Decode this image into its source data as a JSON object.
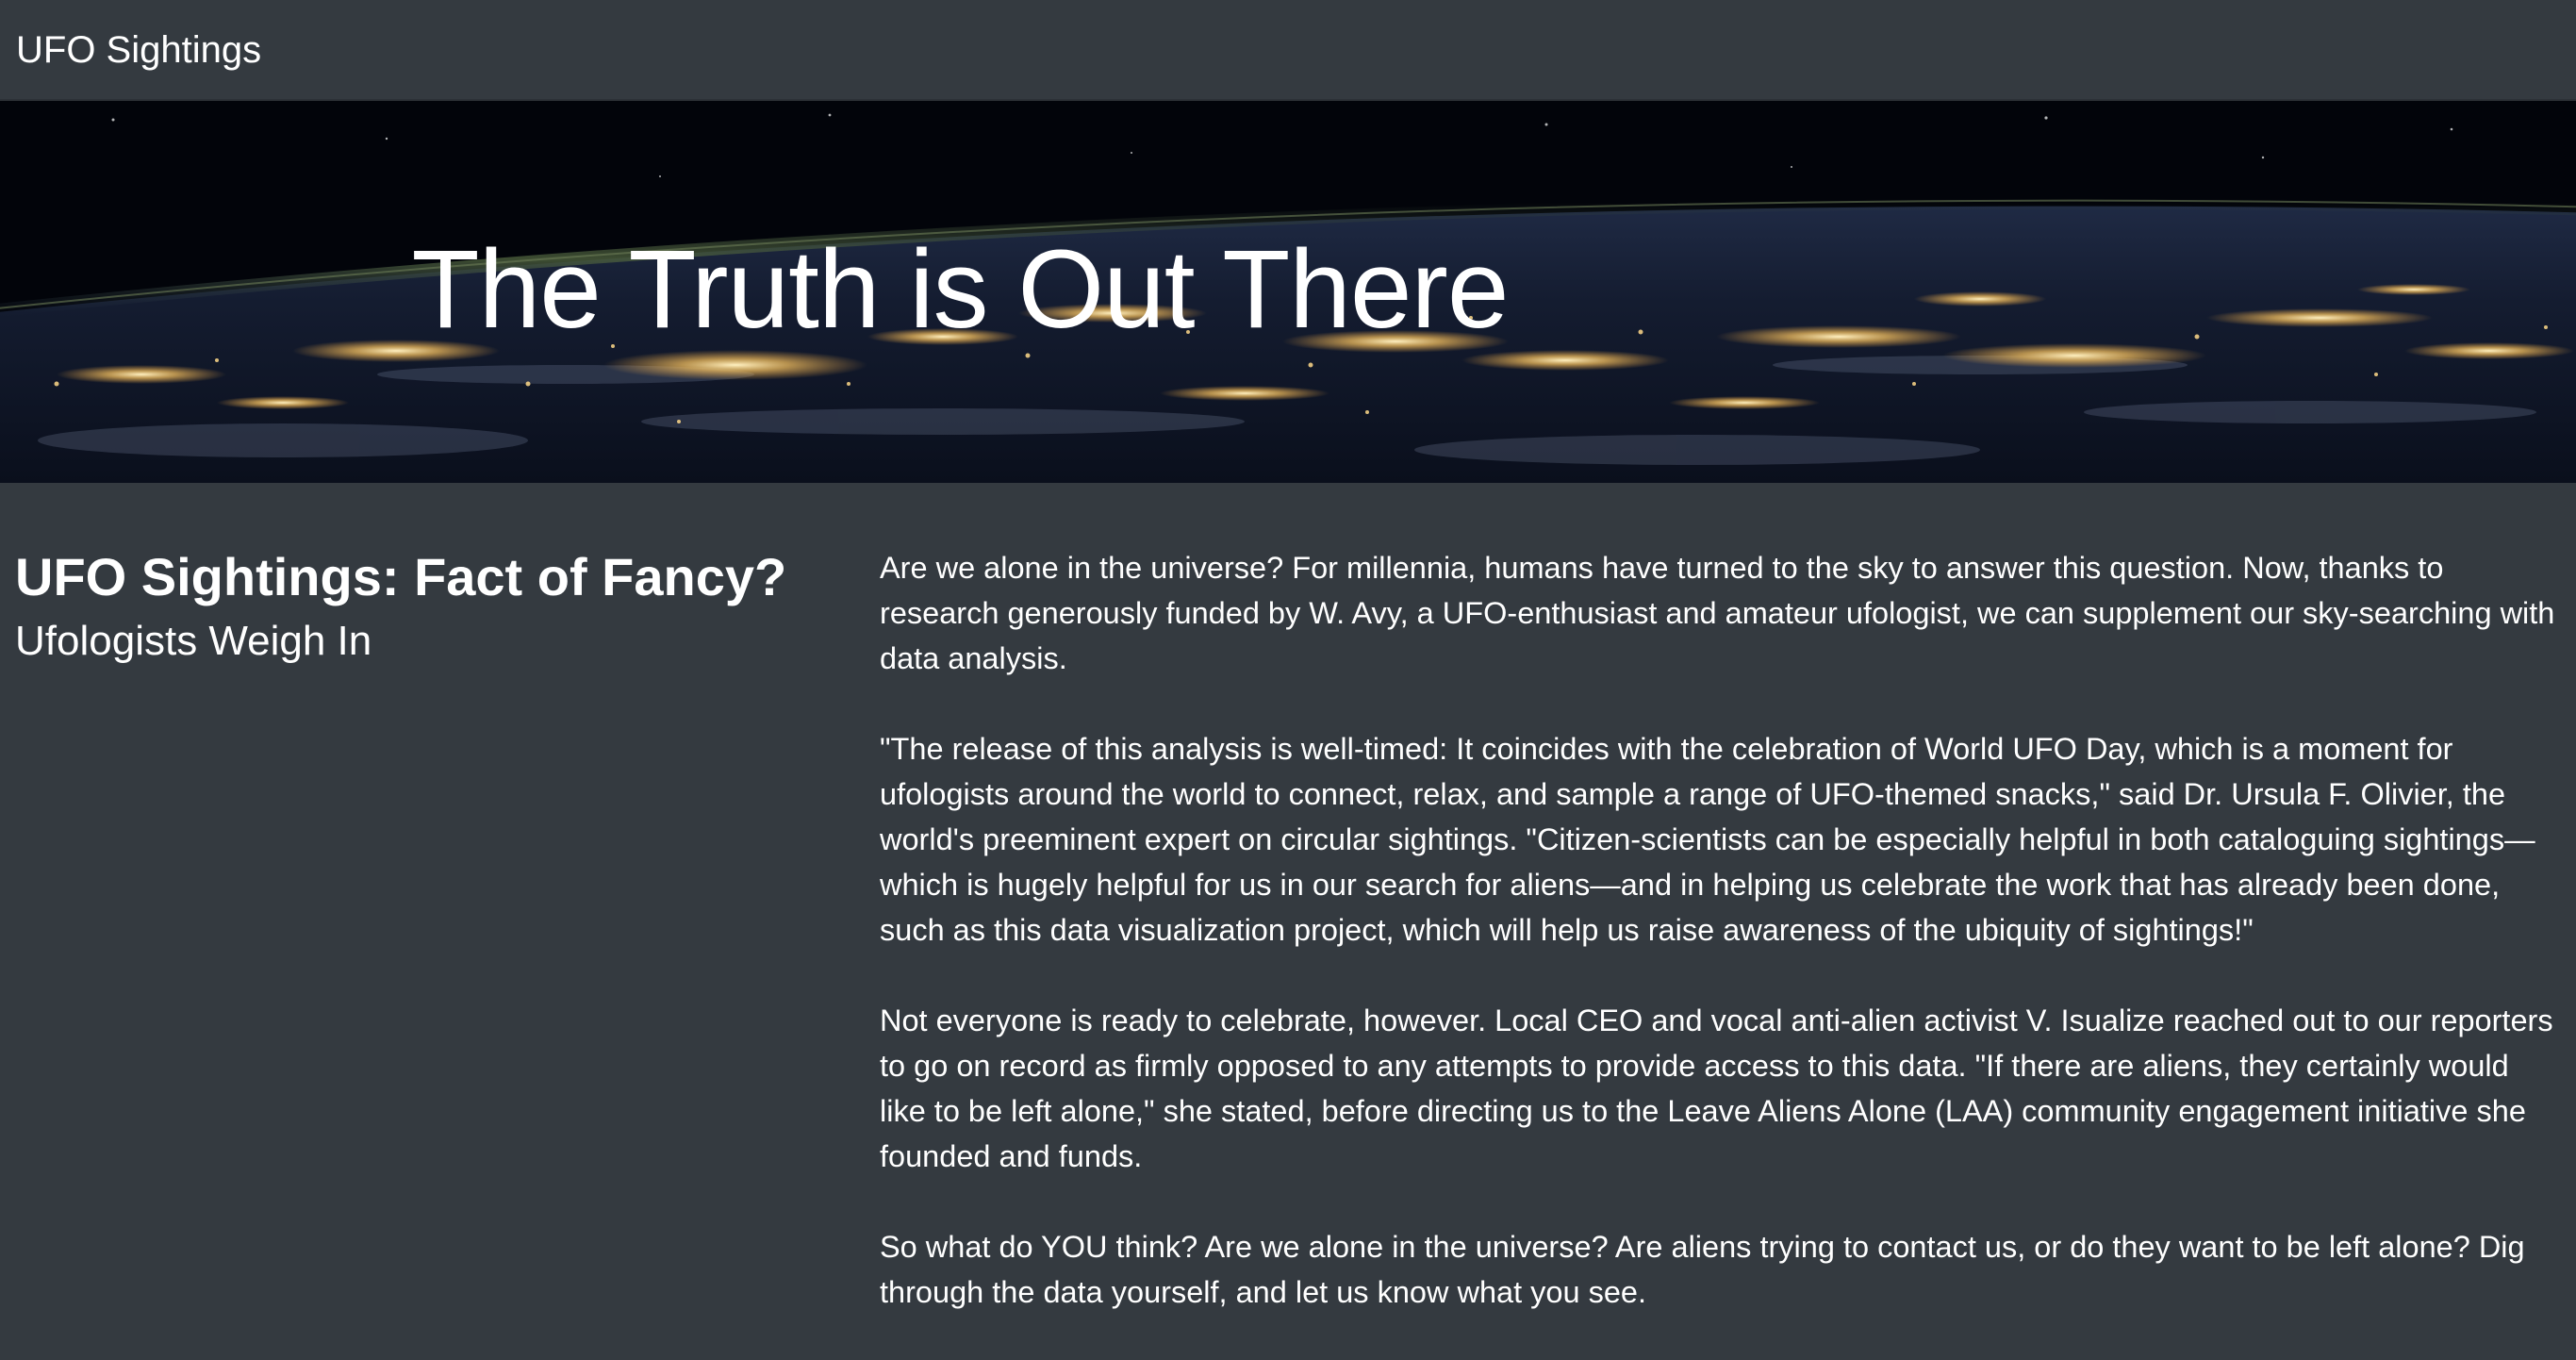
{
  "navbar": {
    "brand": "UFO Sightings"
  },
  "hero": {
    "title": "The Truth is Out There",
    "background_image": "earth-at-night-from-space"
  },
  "left": {
    "headline": "UFO Sightings: Fact of Fancy?",
    "subhead": "Ufologists Weigh In"
  },
  "article": {
    "paragraphs": [
      "Are we alone in the universe? For millennia, humans have turned to the sky to answer this question. Now, thanks to research generously funded by W. Avy, a UFO-enthusiast and amateur ufologist, we can supplement our sky-searching with data analysis.",
      "\"The release of this analysis is well-timed: It coincides with the celebration of World UFO Day, which is a moment for ufologists around the world to connect, relax, and sample a range of UFO-themed snacks,\" said Dr. Ursula F. Olivier, the world's preeminent expert on circular sightings. \"Citizen-scientists can be especially helpful in both cataloguing sightings—which is hugely helpful for us in our search for aliens—and in helping us celebrate the work that has already been done, such as this data visualization project, which will help us raise awareness of the ubiquity of sightings!\"",
      "Not everyone is ready to celebrate, however. Local CEO and vocal anti-alien activist V. Isualize reached out to our reporters to go on record as firmly opposed to any attempts to provide access to this data. \"If there are aliens, they certainly would like to be left alone,\" she stated, before directing us to the Leave Aliens Alone (LAA) community engagement initiative she founded and funds.",
      "So what do YOU think? Are we alone in the universe? Are aliens trying to contact us, or do they want to be left alone? Dig through the data yourself, and let us know what you see."
    ]
  },
  "colors": {
    "background": "#343a40",
    "text": "#ffffff",
    "city_lights": "#ffd98a"
  }
}
